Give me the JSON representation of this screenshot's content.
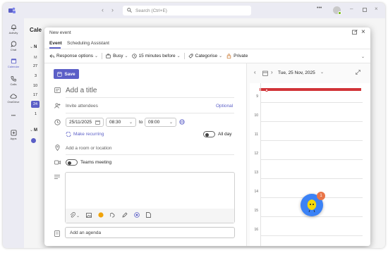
{
  "titlebar": {
    "search_placeholder": "Search (Ctrl+E)"
  },
  "rail": {
    "items": [
      "Activity",
      "Chat",
      "Calendar",
      "Calls",
      "OneDrive",
      "Apps"
    ],
    "more": "•••"
  },
  "background": {
    "heading": "Cale",
    "mini_cal": {
      "header": "N",
      "day_header": "M",
      "days": [
        "27",
        "3",
        "10",
        "17",
        "24",
        "1"
      ],
      "selected_day": "24"
    },
    "section": "M"
  },
  "dialog": {
    "title": "New event",
    "tabs": [
      "Event",
      "Scheduling Assistant"
    ],
    "active_tab": "Event",
    "toolbar": {
      "response": "Response options",
      "busy": "Busy",
      "reminder": "15 minutes before",
      "categorise": "Categorise",
      "private": "Private"
    },
    "save_label": "Save",
    "title_placeholder": "Add a title",
    "attendees_placeholder": "Invite attendees",
    "optional_label": "Optional",
    "start_date": "25/11/2025",
    "start_time": "08:30",
    "to_label": "to",
    "end_time": "09:00",
    "recurring_label": "Make recurring",
    "all_day_label": "All day",
    "location_placeholder": "Add a room or location",
    "teams_label": "Teams meeting",
    "agenda_placeholder": "Add an agenda"
  },
  "calendar_pane": {
    "date": "Tue, 25 Nov, 2025",
    "hours": [
      "9",
      "10",
      "11",
      "12",
      "13",
      "14",
      "15",
      "16"
    ]
  },
  "copilot": {
    "badge": "1"
  },
  "colors": {
    "accent": "#5b5fc7",
    "now_line": "#d13438",
    "badge": "#e97548",
    "copilot_bg": "#3b82f6",
    "copilot_face": "#f5d90a"
  }
}
